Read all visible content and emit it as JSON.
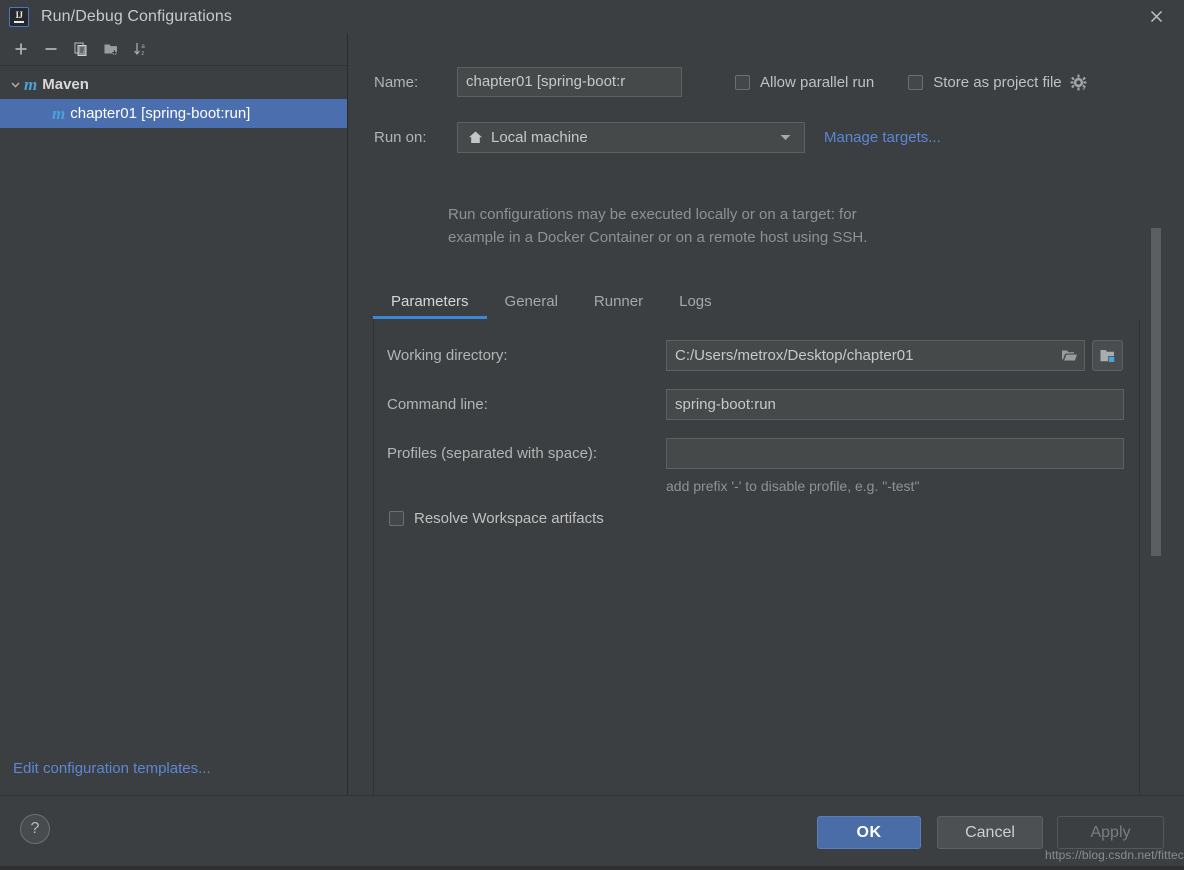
{
  "window": {
    "title": "Run/Debug Configurations",
    "logo_icon": "intellij-idea-logo-icon",
    "close_icon": "close-icon"
  },
  "sidebar": {
    "toolbar": [
      {
        "name": "add-configuration-button",
        "icon": "plus-icon"
      },
      {
        "name": "remove-configuration-button",
        "icon": "minus-icon"
      },
      {
        "name": "copy-configuration-button",
        "icon": "copy-icon"
      },
      {
        "name": "new-folder-button",
        "icon": "folder-add-icon"
      },
      {
        "name": "sort-configurations-button",
        "icon": "sort-az-icon"
      }
    ],
    "tree": {
      "group": {
        "label": "Maven",
        "icon": "maven-icon",
        "expanded": true,
        "chevron": "chevron-down-icon"
      },
      "items": [
        {
          "label": "chapter01 [spring-boot:run]",
          "icon": "maven-icon",
          "selected": true
        }
      ]
    },
    "edit_templates_link": "Edit configuration templates..."
  },
  "form": {
    "name_label": "Name:",
    "name_value": "chapter01 [spring-boot:r",
    "name_placeholder": "",
    "allow_parallel_run": {
      "label": "Allow parallel run",
      "checked": false
    },
    "store_as_project_file": {
      "label": "Store as project file",
      "checked": false,
      "gear_icon": "gear-icon"
    },
    "run_on_label": "Run on:",
    "run_on_value": "Local machine",
    "run_on_icon": "home-icon",
    "manage_targets_link": "Manage targets...",
    "hint_line_1": "Run configurations may be executed locally or on a target: for",
    "hint_line_2": "example in a Docker Container or on a remote host using SSH."
  },
  "tabs": [
    {
      "label": "Parameters",
      "active": true
    },
    {
      "label": "General",
      "active": false
    },
    {
      "label": "Runner",
      "active": false
    },
    {
      "label": "Logs",
      "active": false
    }
  ],
  "parameters": {
    "working_directory": {
      "label": "Working directory:",
      "value": "C:/Users/metrox/Desktop/chapter01",
      "browse_icon": "folder-open-icon",
      "module_icon": "module-folder-icon"
    },
    "command_line": {
      "label": "Command line:",
      "value": "spring-boot:run",
      "placeholder": ""
    },
    "profiles": {
      "label": "Profiles (separated with space):",
      "value": "",
      "placeholder": "",
      "hint": "add prefix '-' to disable profile, e.g. \"-test\""
    },
    "resolve_workspace_artifacts": {
      "label": "Resolve Workspace artifacts",
      "checked": false
    }
  },
  "footer": {
    "help_label": "?",
    "ok_label": "OK",
    "cancel_label": "Cancel",
    "apply_label": "Apply",
    "apply_disabled": true
  },
  "watermark": "https://blog.csdn.net/fittec",
  "colors": {
    "background": "#3c3f41",
    "selection": "#4b6eaf",
    "accent_link": "#5b87d4",
    "tab_underline": "#3d87d6",
    "primary_button": "#4a6da7",
    "maven_icon": "#4ba0d8"
  }
}
